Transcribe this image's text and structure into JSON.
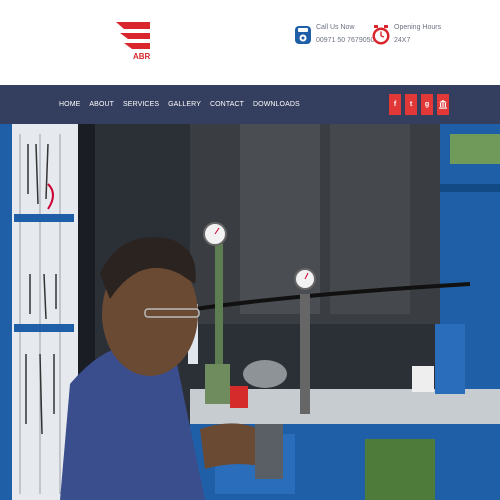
{
  "brand": {
    "name": "ABR",
    "color": "#d9262c"
  },
  "header": {
    "call": {
      "label": "Call Us Now",
      "value": "00971 50 7679050",
      "icon": "phone-icon"
    },
    "hours": {
      "label": "Opening Hours",
      "value": "24X7",
      "icon": "clock-icon"
    }
  },
  "nav": {
    "items": [
      "HOME",
      "ABOUT",
      "SERVICES",
      "GALLERY",
      "CONTACT",
      "DOWNLOADS"
    ],
    "background": "#343e5e"
  },
  "social": [
    {
      "label": "f",
      "icon": "facebook-icon"
    },
    {
      "label": "t",
      "icon": "twitter-icon"
    },
    {
      "label": "g",
      "icon": "google-plus-icon"
    },
    {
      "label": "",
      "icon": "bank-icon"
    }
  ],
  "hero": {
    "icon": "workshop-photo",
    "accent": "#1e5fa8"
  }
}
